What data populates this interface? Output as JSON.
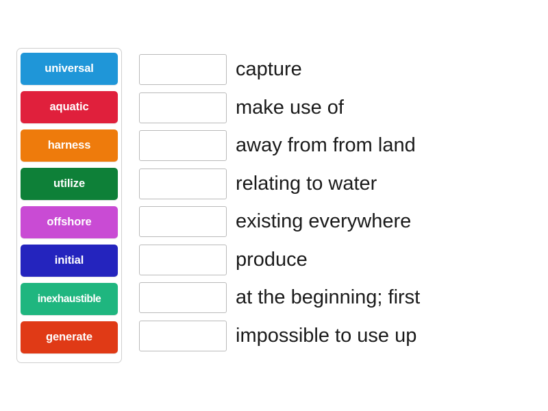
{
  "activity": {
    "type": "match-up",
    "background_color": "#ffffff"
  },
  "tiles_panel": {
    "border_color": "#cfcfcf",
    "items": [
      {
        "label": "universal",
        "color": "#1f96d8",
        "text_color": "#ffffff"
      },
      {
        "label": "aquatic",
        "color": "#e0203c",
        "text_color": "#ffffff"
      },
      {
        "label": "harness",
        "color": "#ee7b0c",
        "text_color": "#ffffff"
      },
      {
        "label": "utilize",
        "color": "#0e8038",
        "text_color": "#ffffff"
      },
      {
        "label": "offshore",
        "color": "#c94bd4",
        "text_color": "#ffffff"
      },
      {
        "label": "initial",
        "color": "#2424be",
        "text_color": "#ffffff"
      },
      {
        "label": "inexhaustible",
        "color": "#1fb67f",
        "text_color": "#ffffff"
      },
      {
        "label": "generate",
        "color": "#e03a16",
        "text_color": "#ffffff"
      }
    ]
  },
  "answer_rows": {
    "slot_border_color": "#b9b9b9",
    "slot_value_placeholder": "",
    "items": [
      {
        "slot_value": "",
        "definition": "capture"
      },
      {
        "slot_value": "",
        "definition": "make use of"
      },
      {
        "slot_value": "",
        "definition": "away from from land"
      },
      {
        "slot_value": "",
        "definition": "relating to water"
      },
      {
        "slot_value": "",
        "definition": "existing everywhere"
      },
      {
        "slot_value": "",
        "definition": "produce"
      },
      {
        "slot_value": "",
        "definition": "at the beginning; first"
      },
      {
        "slot_value": "",
        "definition": "impossible to use up"
      }
    ]
  }
}
